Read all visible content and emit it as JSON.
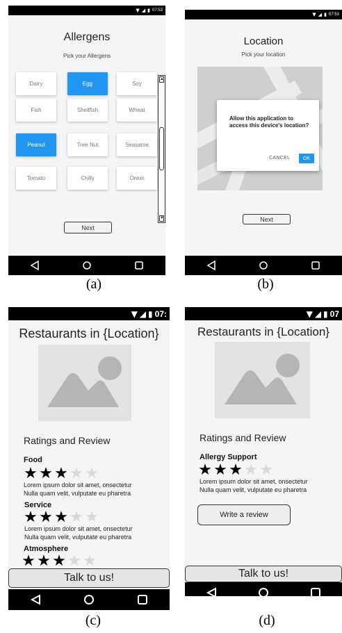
{
  "captions": [
    "(a)",
    "(b)",
    "(c)",
    "(d)"
  ],
  "status": {
    "icons": [
      "wifi-icon",
      "signal-icon",
      "battery-icon"
    ],
    "time_small": "07:53",
    "time_c": "07:",
    "time_d": "07"
  },
  "nav_icons": [
    "back-triangle-icon",
    "home-circle-icon",
    "recents-square-icon"
  ],
  "allergens_screen": {
    "title": "Allergens",
    "subtitle": "Pick your Allergens",
    "items": [
      {
        "label": "Dairy",
        "selected": false
      },
      {
        "label": "Egg",
        "selected": true
      },
      {
        "label": "Soy",
        "selected": false
      },
      {
        "label": "Fish",
        "selected": false
      },
      {
        "label": "Shellfish",
        "selected": false
      },
      {
        "label": "Wheat",
        "selected": false
      },
      {
        "label": "Peanut",
        "selected": true
      },
      {
        "label": "Tree Nut",
        "selected": false
      },
      {
        "label": "Seasame",
        "selected": false
      },
      {
        "label": "Tomato",
        "selected": false
      },
      {
        "label": "Chilly",
        "selected": false
      },
      {
        "label": "Onion",
        "selected": false
      }
    ],
    "next_label": "Next",
    "accent": "#2196f3"
  },
  "location_screen": {
    "title": "Location",
    "subtitle": "Pick your location",
    "dialog": {
      "message": "Allow this application to access this device's location?",
      "cancel_label": "CANCEL",
      "ok_label": "OK"
    },
    "next_label": "Next"
  },
  "restaurants_screen_c": {
    "title": "Restaurants in {Location}",
    "ratings_heading": "Ratings and Review",
    "categories": [
      {
        "name": "Food",
        "rating": 3,
        "max": 5,
        "text_line1": "Lorem ipsum dolor sit amet, onsectetur",
        "text_line2": "Nulla quam velit, vulputate eu pharetra"
      },
      {
        "name": "Service",
        "rating": 3,
        "max": 5,
        "text_line1": "Lorem ipsum dolor sit amet, onsectetur",
        "text_line2": "Nulla quam velit, vulputate eu pharetra"
      },
      {
        "name": "Atmosphere",
        "rating": 3,
        "max": 5
      }
    ],
    "talk_label": "Talk to us!"
  },
  "restaurants_screen_d": {
    "title": "Restaurants in {Location}",
    "ratings_heading": "Ratings and Review",
    "category": {
      "name": "Allergy Support",
      "rating": 3,
      "max": 5,
      "text_line1": "Lorem ipsum dolor sit amet, onsectetur",
      "text_line2": "Nulla quam velit, vulputate eu pharetra"
    },
    "write_review_label": "Write a review",
    "talk_label": "Talk to us!"
  }
}
